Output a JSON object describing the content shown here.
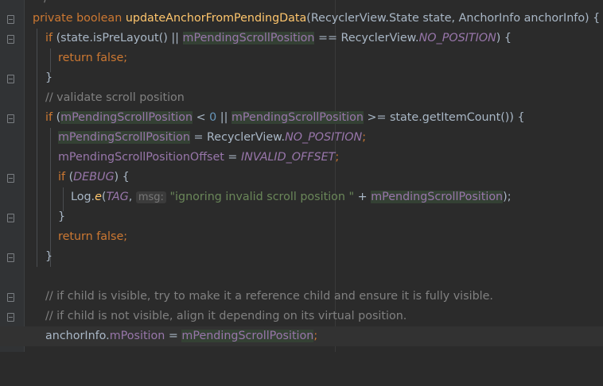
{
  "editor": {
    "language": "java",
    "colors": {
      "background": "#2b2b2b",
      "keyword": "#cc7832",
      "method": "#ffc66d",
      "field": "#9876aa",
      "comment": "#808080",
      "number": "#6897bb",
      "string": "#6a8759",
      "text": "#a9b7c6"
    },
    "code": {
      "l0": {
        "tail": "*/"
      },
      "l1": {
        "kw": "private boolean ",
        "fn": "updateAnchorFromPendingData",
        "rest": "(RecyclerView.State state, AnchorInfo anchorInfo) {"
      },
      "l2": {
        "kw": "if ",
        "a": "(state.isPreLayout() || ",
        "f": "mPendingScrollPosition",
        "b": " == RecyclerView.",
        "c": "NO_POSITION",
        "d": ") {"
      },
      "l3": {
        "kw": "return false",
        "semi": ";"
      },
      "l4": {
        "brace": "}"
      },
      "l5": {
        "comment": "// validate scroll position"
      },
      "l6": {
        "kw": "if ",
        "a": "(",
        "f1": "mPendingScrollPosition",
        "lt": " < ",
        "n": "0",
        "or": " || ",
        "f2": "mPendingScrollPosition",
        "b": " >= state.getItemCount()) {"
      },
      "l7": {
        "f": "mPendingScrollPosition",
        "a": " = RecyclerView.",
        "c": "NO_POSITION",
        "semi": ";"
      },
      "l8": {
        "f": "mPendingScrollPositionOffset",
        "a": " = ",
        "c": "INVALID_OFFSET",
        "semi": ";"
      },
      "l9": {
        "kw": "if ",
        "a": "(",
        "c": "DEBUG",
        "b": ") {"
      },
      "l10": {
        "a": "Log.",
        "m": "e",
        "b": "(",
        "c": "TAG",
        "comma": ", ",
        "hint": "msg:",
        "s": "\"ignoring invalid scroll position \"",
        "plus": " + ",
        "f": "mPendingScrollPosition",
        "end": ");"
      },
      "l11": {
        "brace": "}"
      },
      "l12": {
        "kw": "return false",
        "semi": ";"
      },
      "l13": {
        "brace": "}"
      },
      "l14": {
        "comment": "// if child is visible, try to make it a reference child and ensure it is fully visible."
      },
      "l15": {
        "comment": "// if child is not visible, align it depending on its virtual position."
      },
      "l16": {
        "a": "anchorInfo.",
        "f1": "mPosition",
        "b": " = ",
        "f2": "mPendingScrollPosition",
        "semi": ";"
      }
    }
  }
}
